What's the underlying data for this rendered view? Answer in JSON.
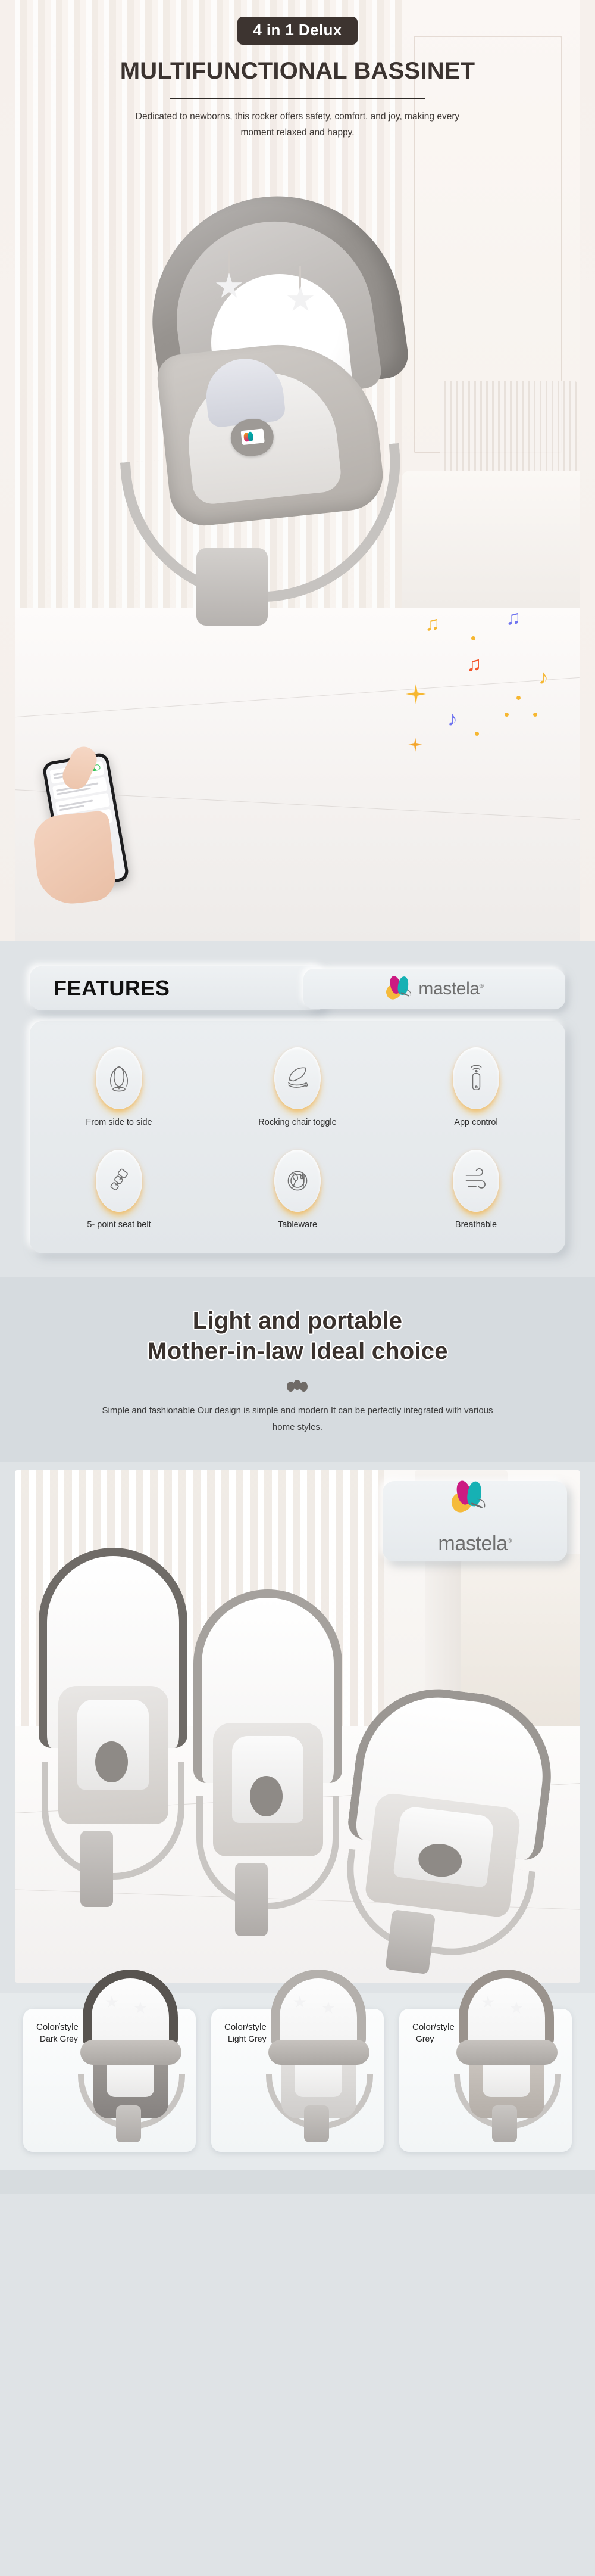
{
  "hero": {
    "badge": "4 in 1 Delux",
    "title": "MULTIFUNCTIONAL BASSINET",
    "subtitle": "Dedicated to newborns, this rocker offers safety, comfort, and joy, making every moment relaxed and happy.",
    "product_logo_alt": "mastela-butterfly-logo"
  },
  "brand": {
    "name": "mastela",
    "trademark": "®",
    "colors": {
      "wing_pink": "#cc1b82",
      "wing_teal": "#16b1b4",
      "wing_yellow": "#f6b731",
      "wordmark": "#6f6f6f"
    }
  },
  "features": {
    "heading": "FEATURES",
    "items": [
      {
        "icon": "side-to-side-swing-icon",
        "label": "From side to side"
      },
      {
        "icon": "rocking-chair-icon",
        "label": "Rocking chair toggle"
      },
      {
        "icon": "app-remote-control-icon",
        "label": "App control"
      },
      {
        "icon": "seat-belt-buckle-icon",
        "label": "5- point seat belt"
      },
      {
        "icon": "tableware-plate-icon",
        "label": "Tableware"
      },
      {
        "icon": "breathable-airflow-icon",
        "label": "Breathable"
      }
    ]
  },
  "portable": {
    "title_line1": "Light and portable",
    "title_line2": "Mother-in-law Ideal choice",
    "divider": "three-dots-ornament",
    "body": "Simple and fashionable Our design is simple and modern It can be perfectly integrated with various home styles."
  },
  "lifestyle": {
    "image_alt": "three-bassinets-in-living-room"
  },
  "colorway": {
    "label": "Color/style",
    "options": [
      {
        "name": "Dark Grey",
        "swatch": "#585450"
      },
      {
        "name": "Light Grey",
        "swatch": "#b4b0ac"
      },
      {
        "name": "Grey",
        "swatch": "#9a938d"
      }
    ]
  },
  "theme": {
    "page_background": "#dfe3e6",
    "badge_background": "#3d3430",
    "heading_color": "#3b3330",
    "glow_color": "#f6b731"
  }
}
